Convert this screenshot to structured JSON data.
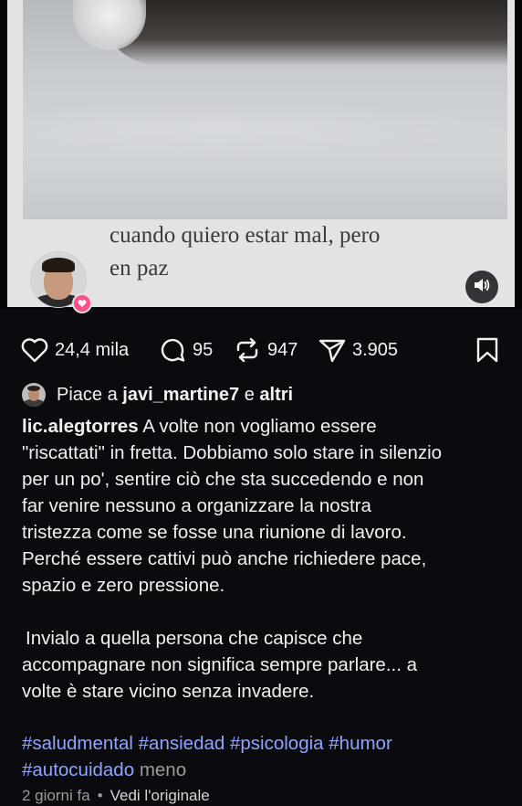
{
  "media": {
    "caption": "cuando quiero estar mal, pero\nen paz",
    "sound_icon": "speaker-icon",
    "badge_icon": "heart-icon"
  },
  "actions": {
    "likes": "24,4 mila",
    "comments": "95",
    "reposts": "947",
    "shares": "3.905"
  },
  "liked_by": {
    "prefix": "Piace a",
    "user": "javi_martine7",
    "conj": "e",
    "others": "altri"
  },
  "post": {
    "username": "lic.alegtorres",
    "lines": [
      " A volte non vogliamo essere",
      "\"riscattati\" in fretta. Dobbiamo solo stare in silenzio",
      "per un po', sentire ciò che sta succedendo e non",
      "far venire nessuno a organizzare la nostra",
      "tristezza come se fosse una riunione di lavoro.",
      "Perché essere cattivi può anche richiedere pace,",
      "spazio e zero pressione."
    ],
    "lines2": [
      "Invialo a quella persona che capisce che",
      "accompagnare non significa sempre parlare... a",
      "volte è stare vicino senza invadere."
    ],
    "hashtags": [
      "#saludmental",
      "#ansiedad",
      "#psicologia",
      "#humor",
      "#autocuidado"
    ],
    "less_label": "meno"
  },
  "meta": {
    "time": "2 giorni fa",
    "see_original": "Vedi l'originale"
  },
  "colors": {
    "background": "#0b0b0f",
    "hashtag": "#8fa3ff",
    "heart_badge": "#ff4f8b"
  }
}
